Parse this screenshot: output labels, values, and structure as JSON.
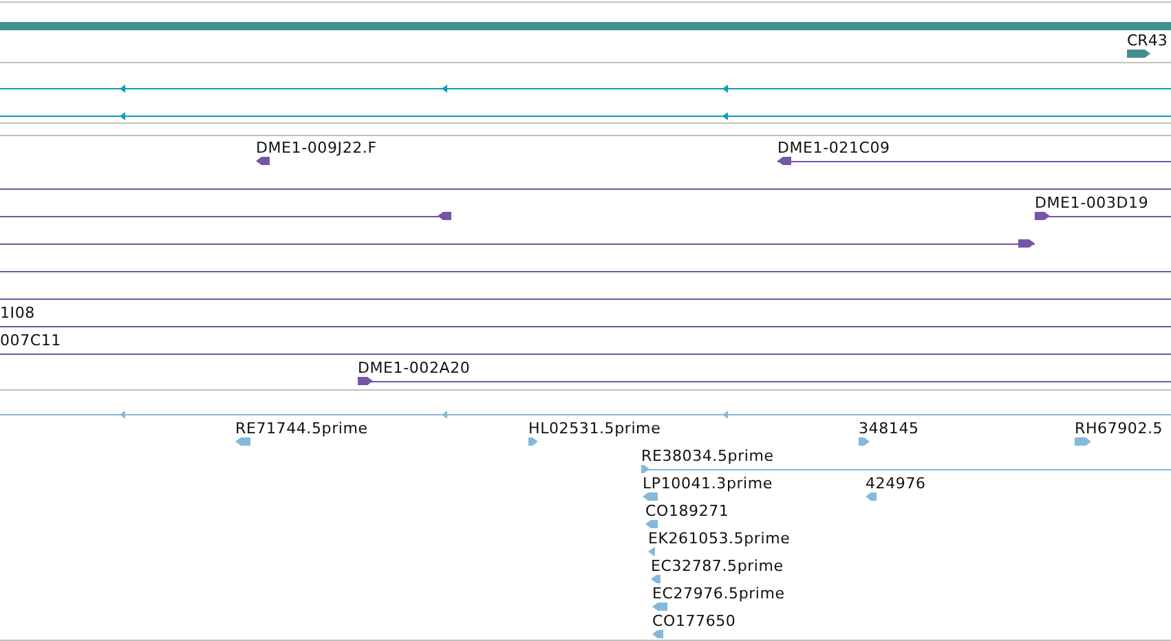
{
  "tracks": [
    {
      "kind": "gene",
      "features": [
        {
          "kind": "arrow",
          "label": "CR43",
          "forward": true
        }
      ]
    },
    {
      "kind": "transcript",
      "features": [
        {
          "kind": "arrow",
          "forward": false
        },
        {
          "kind": "arrow",
          "forward": false
        }
      ]
    },
    {
      "kind": "clone",
      "features": [
        {
          "kind": "arrow",
          "label": "DME1-009J22.F",
          "forward": false
        },
        {
          "kind": "arrow",
          "label": "DME1-021C09",
          "forward": false
        },
        {
          "kind": "line"
        },
        {
          "kind": "arrow",
          "forward": false
        },
        {
          "kind": "arrow",
          "label": "DME1-003D19",
          "forward": true
        },
        {
          "kind": "arrow",
          "forward": true
        },
        {
          "kind": "line"
        },
        {
          "kind": "line"
        },
        {
          "kind": "line",
          "label": "1I08"
        },
        {
          "kind": "line",
          "label": "007C11"
        },
        {
          "kind": "arrow",
          "label": "DME1-002A20",
          "forward": true
        }
      ]
    },
    {
      "kind": "est",
      "features": [
        {
          "kind": "arrow",
          "forward": false
        },
        {
          "kind": "arrow",
          "label": "RE71744.5prime",
          "forward": false
        },
        {
          "kind": "arrow",
          "label": "HL02531.5prime",
          "forward": true
        },
        {
          "kind": "arrow",
          "label": "348145",
          "forward": true
        },
        {
          "kind": "arrow",
          "label": "RH67902.5",
          "forward": true
        },
        {
          "kind": "arrow",
          "label": "RE38034.5prime",
          "forward": true
        },
        {
          "kind": "arrow",
          "label": "LP10041.3prime",
          "forward": false
        },
        {
          "kind": "arrow",
          "label": "424976",
          "forward": false
        },
        {
          "kind": "arrow",
          "label": "CO189271",
          "forward": false
        },
        {
          "kind": "arrow",
          "label": "EK261053.5prime",
          "forward": false
        },
        {
          "kind": "arrow",
          "label": "EC32787.5prime",
          "forward": false
        },
        {
          "kind": "arrow",
          "label": "EC27976.5prime",
          "forward": false
        },
        {
          "kind": "arrow",
          "label": "CO177650",
          "forward": false
        }
      ]
    }
  ]
}
